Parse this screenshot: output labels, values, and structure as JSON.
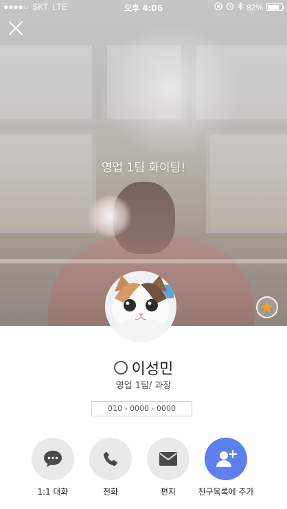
{
  "status_bar": {
    "signal": "●●●●○",
    "carrier": "SKT",
    "network": "LTE",
    "time": "오후 4:06",
    "battery_percent": "82%",
    "battery_level": 0.82
  },
  "profile": {
    "status_message": "영업 1팀 화이팅!",
    "name": "이성민",
    "department": "영업 1팀/ 과장",
    "phone": "010 - 0000 - 0000"
  },
  "actions": [
    {
      "label": "1:1 대화",
      "icon": "chat-bubble-icon"
    },
    {
      "label": "전화",
      "icon": "phone-icon"
    },
    {
      "label": "편지",
      "icon": "mail-icon"
    },
    {
      "label": "친구목록에 추가",
      "icon": "add-friend-icon"
    }
  ],
  "colors": {
    "primary_action": "#5f7ff0",
    "favorite_star": "#f5a31a",
    "action_bg": "#e9e9e9"
  }
}
